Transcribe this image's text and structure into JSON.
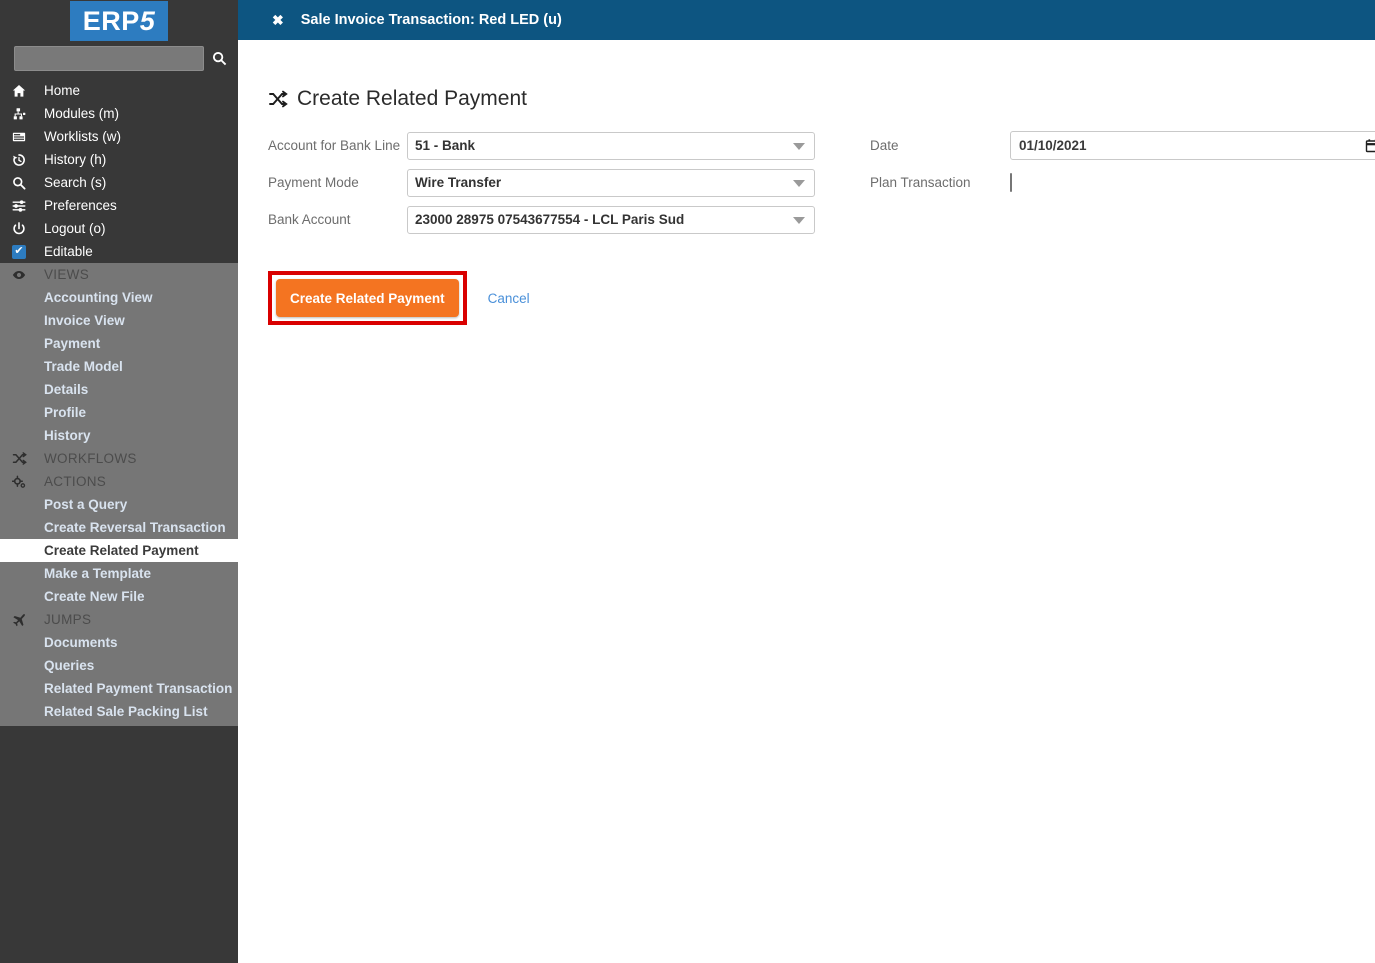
{
  "brand": {
    "logo_text_main": "ERP",
    "logo_text_accent": "5",
    "logo_bg": "#2d7cc0"
  },
  "search": {
    "value": "",
    "placeholder": "",
    "icon": "search-icon"
  },
  "sidebar": {
    "nav": [
      {
        "icon": "home-icon",
        "label": "Home"
      },
      {
        "icon": "modules-icon",
        "label": "Modules (m)"
      },
      {
        "icon": "worklists-icon",
        "label": "Worklists (w)"
      },
      {
        "icon": "history-icon",
        "label": "History (h)"
      },
      {
        "icon": "search-icon",
        "label": "Search (s)"
      },
      {
        "icon": "preferences-icon",
        "label": "Preferences"
      },
      {
        "icon": "logout-icon",
        "label": "Logout (o)"
      },
      {
        "icon": "checkbox-checked-icon",
        "label": "Editable"
      }
    ],
    "sections": [
      {
        "icon": "eye-icon",
        "title": "VIEWS",
        "items": [
          {
            "label": "Accounting View",
            "selected": false
          },
          {
            "label": "Invoice View",
            "selected": false
          },
          {
            "label": "Payment",
            "selected": false
          },
          {
            "label": "Trade Model",
            "selected": false
          },
          {
            "label": "Details",
            "selected": false
          },
          {
            "label": "Profile",
            "selected": false
          },
          {
            "label": "History",
            "selected": false
          }
        ]
      },
      {
        "icon": "shuffle-icon",
        "title": "WORKFLOWS",
        "items": []
      },
      {
        "icon": "gears-icon",
        "title": "ACTIONS",
        "items": [
          {
            "label": "Post a Query",
            "selected": false
          },
          {
            "label": "Create Reversal Transaction",
            "selected": false
          },
          {
            "label": "Create Related Payment",
            "selected": true
          },
          {
            "label": "Make a Template",
            "selected": false
          },
          {
            "label": "Create New File",
            "selected": false
          }
        ]
      },
      {
        "icon": "plane-icon",
        "title": "JUMPS",
        "items": [
          {
            "label": "Documents",
            "selected": false
          },
          {
            "label": "Queries",
            "selected": false
          },
          {
            "label": "Related Payment Transaction",
            "selected": false
          },
          {
            "label": "Related Sale Packing List",
            "selected": false
          }
        ]
      }
    ]
  },
  "topbar": {
    "close_icon": "close-icon",
    "close_glyph": "✖",
    "title": "Sale Invoice Transaction: Red LED (u)",
    "bg": "#0d5581"
  },
  "page": {
    "icon": "shuffle-icon",
    "title": "Create Related Payment"
  },
  "form": {
    "left": [
      {
        "label": "Account for Bank Line",
        "value": "51 - Bank",
        "control": "select"
      },
      {
        "label": "Payment Mode",
        "value": "Wire Transfer",
        "control": "select"
      },
      {
        "label": "Bank Account",
        "value": "23000 28975 07543677554 - LCL Paris Sud",
        "control": "select"
      }
    ],
    "right": [
      {
        "label": "Date",
        "value": "01/10/2021",
        "control": "date"
      },
      {
        "label": "Plan Transaction",
        "value": "",
        "control": "checkbox",
        "checked": false
      }
    ]
  },
  "actions": {
    "submit_label": "Create Related Payment",
    "submit_color": "#f47421",
    "cancel_label": "Cancel",
    "cancel_color": "#4a90d9",
    "highlight_color": "#d90000"
  }
}
